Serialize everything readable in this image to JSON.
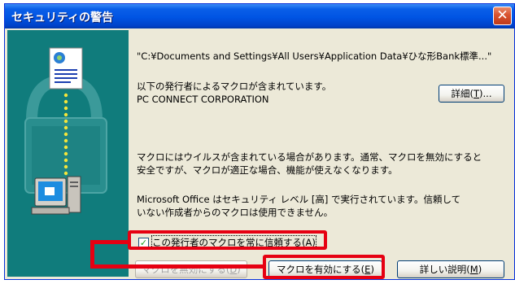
{
  "window": {
    "title": "セキュリティの警告",
    "close_glyph": "✕"
  },
  "message": {
    "file_path": "\"C:¥Documents and Settings¥All Users¥Application Data¥ひな形Bank標準...\"",
    "publisher_line": "以下の発行者によるマクロが含まれています。",
    "publisher_name": "PC CONNECT CORPORATION",
    "warning_line1": "マクロにはウイルスが含まれている場合があります。通常、マクロを無効にすると",
    "warning_line2": "安全ですが、マクロが適正な場合、機能が使えなくなります。",
    "office_line1": "Microsoft Office はセキュリティ レベル [高] で実行されています。信頼して",
    "office_line2": "いない作成者からのマクロは使用できません。"
  },
  "buttons": {
    "details": "詳細(",
    "details_key": "T",
    "details_suffix": ")...",
    "disable_macros": "マクロを無効にする(",
    "disable_key": "D",
    "disable_suffix": ")",
    "enable_macros": "マクロを有効にする(",
    "enable_key": "E",
    "enable_suffix": ")",
    "more_info": "詳しい説明(",
    "more_info_key": "M",
    "more_info_suffix": ")"
  },
  "checkbox": {
    "label": "この発行者のマクロを常に信頼する(",
    "key": "A",
    "label_suffix": ")",
    "checked": true,
    "check_glyph": "✓"
  },
  "annotation": {
    "color": "#e60012"
  },
  "icons": [
    "certificate-document-icon",
    "padlock-icon",
    "computer-icon",
    "close-icon",
    "checkmark-icon"
  ]
}
